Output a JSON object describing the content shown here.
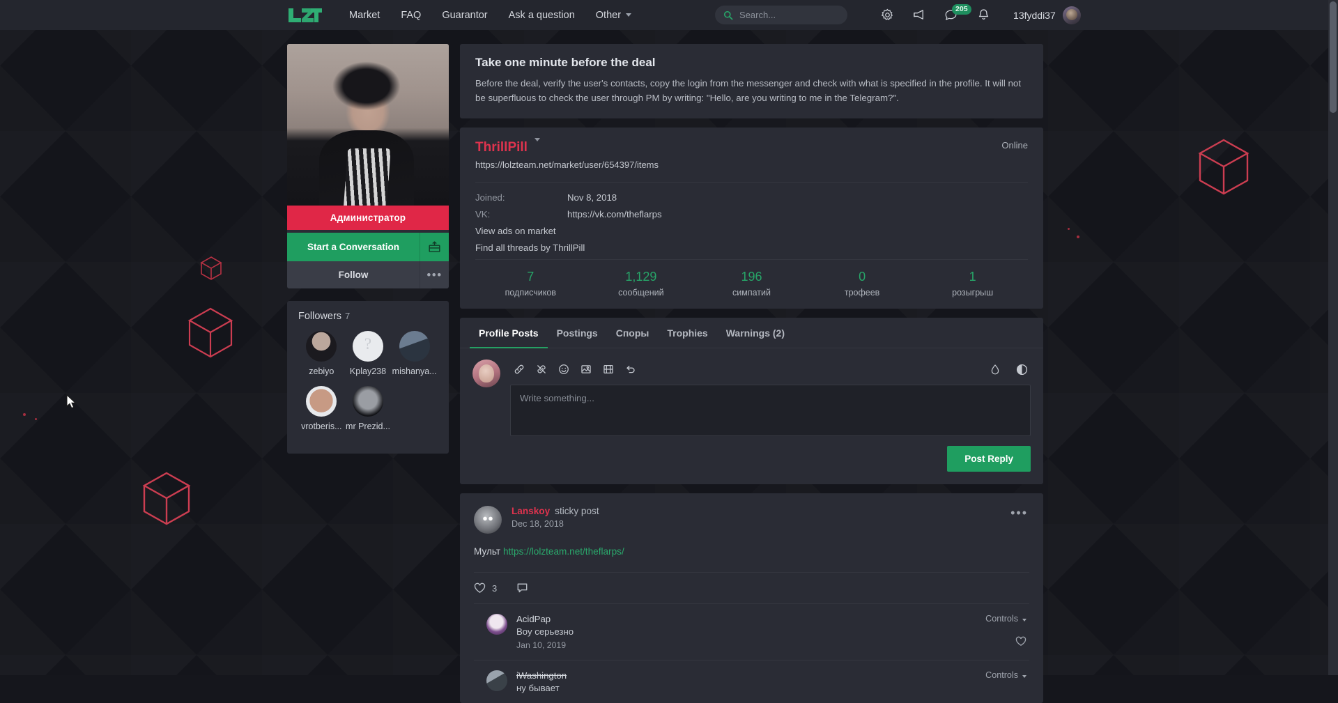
{
  "header": {
    "logo_alt": "LZT",
    "nav": [
      {
        "label": "Market",
        "has_caret": false
      },
      {
        "label": "FAQ",
        "has_caret": false
      },
      {
        "label": "Guarantor",
        "has_caret": false
      },
      {
        "label": "Ask a question",
        "has_caret": false
      },
      {
        "label": "Other",
        "has_caret": true
      }
    ],
    "search_placeholder": "Search...",
    "search_value": "",
    "icons": [
      "gear-icon",
      "megaphone-icon",
      "conversations-icon",
      "bell-icon"
    ],
    "messages_badge": "205",
    "username": "13fyddi37"
  },
  "notice": {
    "title": "Take one minute before the deal",
    "text": "Before the deal, verify the user's contacts, copy the login from the messenger and check with what is specified in the profile. It will not be superfluous to check the user through PM by writing: \"Hello, are you writing to me in the Telegram?\"."
  },
  "sidebar": {
    "role_badge": "Администратор",
    "start_conversation": "Start a Conversation",
    "follow": "Follow",
    "more": "•••",
    "followers_label": "Followers",
    "followers_count": "7",
    "followers": [
      {
        "name": "zebiyo"
      },
      {
        "name": "Kplay238"
      },
      {
        "name": "mishanya..."
      },
      {
        "name": "vrotberis..."
      },
      {
        "name": "mr Prezid..."
      }
    ]
  },
  "profile": {
    "name": "ThrillPill",
    "status": "Online",
    "url": "https://lolzteam.net/market/user/654397/items",
    "fields": [
      {
        "label": "Joined:",
        "value": "Nov 8, 2018"
      },
      {
        "label": "VK:",
        "value": "https://vk.com/theflarps"
      }
    ],
    "links": [
      "View ads on market",
      "Find all threads by ThrillPill"
    ],
    "stats": [
      {
        "num": "7",
        "label": "подписчиков"
      },
      {
        "num": "1,129",
        "label": "сообщений"
      },
      {
        "num": "196",
        "label": "симпатий"
      },
      {
        "num": "0",
        "label": "трофеев"
      },
      {
        "num": "1",
        "label": "розыгрыш"
      }
    ]
  },
  "tabs": [
    {
      "label": "Profile Posts",
      "active": true
    },
    {
      "label": "Postings",
      "active": false
    },
    {
      "label": "Споры",
      "active": false
    },
    {
      "label": "Trophies",
      "active": false
    },
    {
      "label": "Warnings (2)",
      "active": false
    }
  ],
  "editor": {
    "placeholder": "Write something...",
    "toolbar_icons": [
      "link-icon",
      "unlink-icon",
      "emoji-icon",
      "image-icon",
      "media-icon",
      "undo-icon"
    ],
    "right_icons": [
      "ink-drop-icon",
      "contrast-toggle-icon"
    ],
    "post_reply": "Post Reply"
  },
  "post": {
    "author": "Lanskoy",
    "sticky_label": "sticky post",
    "date": "Dec 18, 2018",
    "body_prefix": "Мульт ",
    "body_link": "https://lolzteam.net/theflarps/",
    "likes": "3",
    "menu": "•••",
    "comments": [
      {
        "author": "AcidPap",
        "struck": false,
        "text": "Воу серьезно",
        "date": "Jan 10, 2019",
        "controls": "Controls"
      },
      {
        "author": "iWashington",
        "struck": true,
        "text": "ну бывает",
        "date": "",
        "controls": "Controls"
      }
    ]
  },
  "colors": {
    "accent_green": "#1f9e60",
    "accent_red": "#e0334e",
    "stat_green": "#27a568",
    "panel_bg": "#2a2c35",
    "page_bg": "#14151b"
  }
}
